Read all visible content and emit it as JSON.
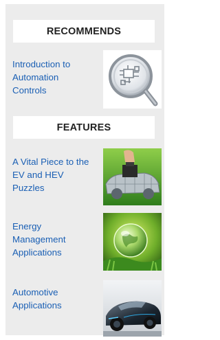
{
  "recommends": {
    "header": "RECOMMENDS",
    "items": [
      {
        "title": "Introduction to Automation Controls",
        "thumb_icon": "magnifier-circuit-image"
      }
    ]
  },
  "features": {
    "header": "FEATURES",
    "items": [
      {
        "title": "A Vital Piece to the EV and HEV Puzzles",
        "thumb_icon": "puzzle-car-image"
      },
      {
        "title": "Energy Management Applications",
        "thumb_icon": "glass-globe-image"
      },
      {
        "title": "Automotive Applications",
        "thumb_icon": "sports-car-image"
      }
    ]
  },
  "colors": {
    "panel_bg": "#ececec",
    "header_bg": "#ffffff",
    "link": "#1a5fb4",
    "header_text": "#222222"
  }
}
